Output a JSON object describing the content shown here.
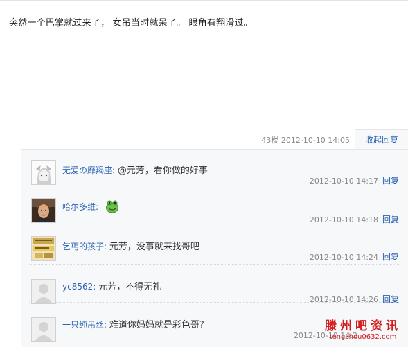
{
  "post": {
    "text": "突然一个巴掌就过来了， 女吊当时就呆了。 眼角有翔滑过。"
  },
  "floor": {
    "meta": "43楼 2012-10-10 14:05",
    "collapse_label": "收起回复"
  },
  "replies": [
    {
      "user": "无爱の靡羯座",
      "colon": ":",
      "content": "@元芳，看你做的好事",
      "time": "2012-10-10 14:17",
      "reply_label": "回复",
      "avatar_icon": "anime-avatar"
    },
    {
      "user": "哈尔多维",
      "colon": ":",
      "content": "",
      "time": "2012-10-10 14:18",
      "reply_label": "回复",
      "avatar_icon": "photo-avatar",
      "emoticon": "green-frog-emoticon"
    },
    {
      "user": "乞丐的孩子",
      "colon": ":",
      "content": "元芳，没事就来找哥吧",
      "time": "2012-10-10 14:24",
      "reply_label": "回复",
      "avatar_icon": "image-avatar"
    },
    {
      "user": "yc8562",
      "colon": ":",
      "content": "元芳，不得无礼",
      "time": "2012-10-10 14:26",
      "reply_label": "回复",
      "avatar_icon": "default-avatar"
    },
    {
      "user": "一只纯吊丝",
      "colon": ":",
      "content": "难道你妈妈就是彩色哥?",
      "time": "2012-10-10 14:2",
      "reply_label": "回复",
      "avatar_icon": "default-avatar"
    }
  ],
  "watermark": {
    "title": "滕州吧资讯",
    "url": "tengzhou0632.com"
  },
  "colors": {
    "link": "#2d64b3",
    "meta": "#888888",
    "panel": "#f7f8fa",
    "watermark": "#d21b1b"
  }
}
